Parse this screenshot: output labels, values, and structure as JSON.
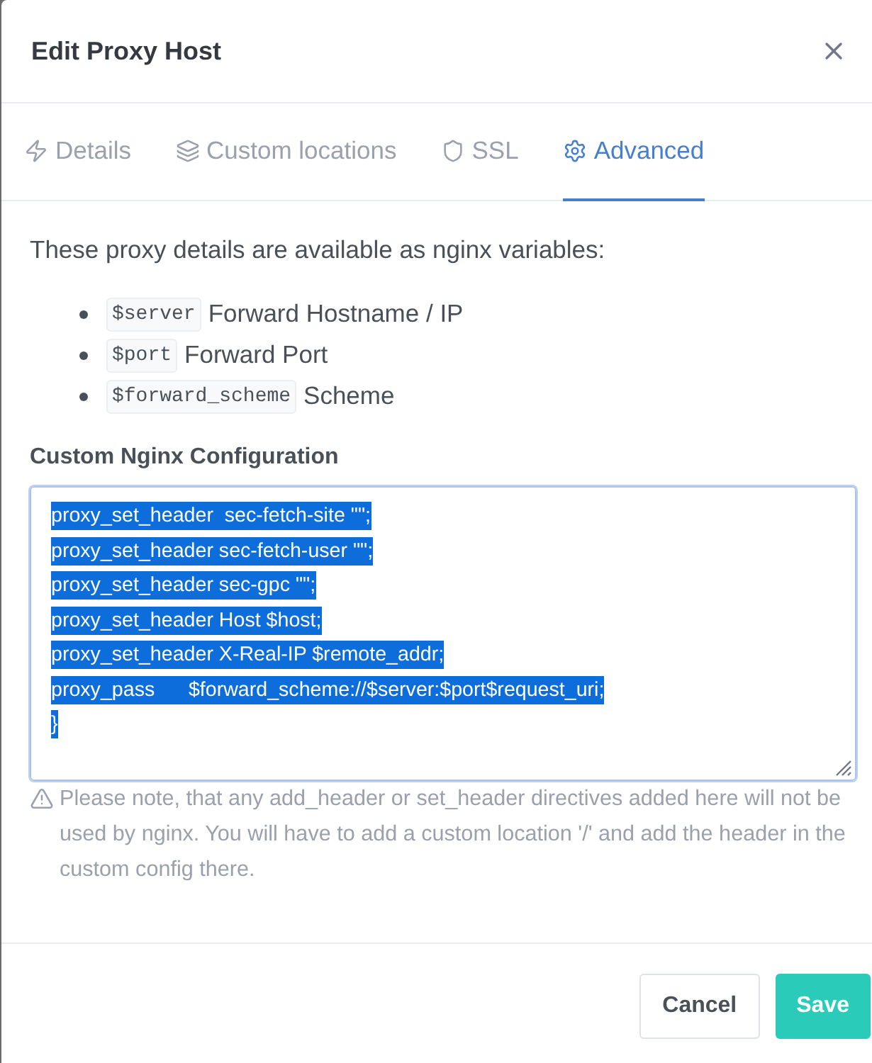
{
  "dialog": {
    "title": "Edit Proxy Host"
  },
  "tabs": [
    {
      "label": "Details",
      "selected": false
    },
    {
      "label": "Custom locations",
      "selected": false
    },
    {
      "label": "SSL",
      "selected": false
    },
    {
      "label": "Advanced",
      "selected": true
    }
  ],
  "advanced": {
    "intro": "These proxy details are available as nginx variables:",
    "variables": [
      {
        "code": "$server",
        "label": "Forward Hostname / IP"
      },
      {
        "code": "$port",
        "label": "Forward Port"
      },
      {
        "code": "$forward_scheme",
        "label": "Scheme"
      }
    ],
    "config": {
      "label": "Custom Nginx Configuration",
      "focused": true,
      "text_selected": true,
      "lines": [
        "proxy_set_header  sec-fetch-site \"\";",
        "proxy_set_header sec-fetch-user \"\";",
        "proxy_set_header sec-gpc \"\";",
        "proxy_set_header Host $host;",
        "proxy_set_header X-Real-IP $remote_addr;",
        "proxy_pass      $forward_scheme://$server:$port$request_uri;",
        "}"
      ]
    },
    "note": "Please note, that any add_header or set_header directives added here will not be used by nginx. You will have to add a custom location '/' and add the header in the custom config there."
  },
  "buttons": [
    {
      "label": "Cancel",
      "kind": "secondary"
    },
    {
      "label": "Save",
      "kind": "primary"
    }
  ]
}
